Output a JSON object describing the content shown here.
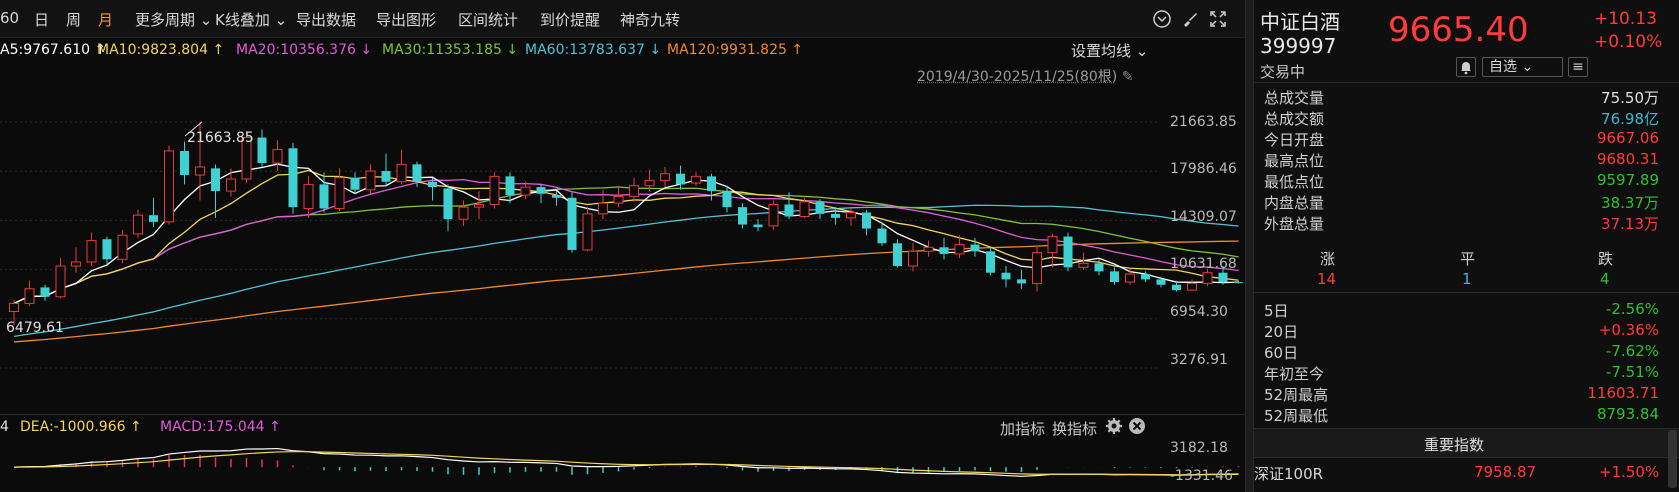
{
  "toolbar": {
    "items": [
      "60",
      "日",
      "周",
      "月",
      "更多周期",
      "K线叠加",
      "导出数据",
      "导出图形",
      "区间统计",
      "到价提醒",
      "神奇九转"
    ],
    "active": "月"
  },
  "ma_row": {
    "ma5": "A5:9767.610",
    "ma5_arrow": "↑",
    "ma10": "MA10:9823.804",
    "ma10_arrow": "↑",
    "ma20": "MA20:10356.376",
    "ma20_arrow": "↓",
    "ma30": "MA30:11353.185",
    "ma30_arrow": "↓",
    "ma60": "MA60:13783.637",
    "ma60_arrow": "↓",
    "ma120": "MA120:9931.825",
    "ma120_arrow": "↑",
    "settings_label": "设置均线"
  },
  "date_range": "2019/4/30-2025/11/25(80根)",
  "colors": {
    "up": "#e8383d",
    "down": "#3fd1d1",
    "ma5": "#ffffff",
    "ma10": "#f2d45c",
    "ma20": "#e05cd8",
    "ma30": "#7dc43a",
    "ma60": "#4fc4d6",
    "ma120": "#f0892c"
  },
  "chart_data": {
    "type": "candlestick",
    "title": "",
    "y_ticks": [
      "21663.85",
      "17986.46",
      "14309.07",
      "10631.68",
      "6954.30",
      "3276.91"
    ],
    "ylim": [
      3276.91,
      21663.85
    ],
    "annotations": {
      "high": "21663.85",
      "low": "6479.61"
    },
    "candles": [
      {
        "o": 7500,
        "c": 8100,
        "h": 8400,
        "l": 6479.61
      },
      {
        "o": 8100,
        "c": 9200,
        "h": 9800,
        "l": 7900
      },
      {
        "o": 9300,
        "c": 8600,
        "h": 9500,
        "l": 8300
      },
      {
        "o": 8600,
        "c": 10900,
        "h": 11500,
        "l": 8500
      },
      {
        "o": 10900,
        "c": 11200,
        "h": 12300,
        "l": 10400
      },
      {
        "o": 11200,
        "c": 12800,
        "h": 13400,
        "l": 10900
      },
      {
        "o": 12900,
        "c": 11400,
        "h": 13100,
        "l": 11000
      },
      {
        "o": 11400,
        "c": 13200,
        "h": 13600,
        "l": 11100
      },
      {
        "o": 13300,
        "c": 14700,
        "h": 15100,
        "l": 13000
      },
      {
        "o": 14700,
        "c": 14200,
        "h": 16000,
        "l": 13800
      },
      {
        "o": 14200,
        "c": 19500,
        "h": 19900,
        "l": 14000
      },
      {
        "o": 19500,
        "c": 17700,
        "h": 20200,
        "l": 17000
      },
      {
        "o": 17700,
        "c": 18300,
        "h": 21663.85,
        "l": 15800
      },
      {
        "o": 18200,
        "c": 16500,
        "h": 18500,
        "l": 14500
      },
      {
        "o": 16500,
        "c": 17400,
        "h": 18200,
        "l": 16100
      },
      {
        "o": 17400,
        "c": 20500,
        "h": 21000,
        "l": 17100
      },
      {
        "o": 20500,
        "c": 18600,
        "h": 21100,
        "l": 18300
      },
      {
        "o": 18600,
        "c": 19600,
        "h": 20300,
        "l": 18000
      },
      {
        "o": 19700,
        "c": 15300,
        "h": 20100,
        "l": 14800
      },
      {
        "o": 15200,
        "c": 17000,
        "h": 17600,
        "l": 14500
      },
      {
        "o": 17000,
        "c": 15200,
        "h": 17900,
        "l": 14900
      },
      {
        "o": 15200,
        "c": 17500,
        "h": 18200,
        "l": 15000
      },
      {
        "o": 17500,
        "c": 16600,
        "h": 17900,
        "l": 16300
      },
      {
        "o": 16600,
        "c": 18000,
        "h": 18500,
        "l": 16300
      },
      {
        "o": 18000,
        "c": 17200,
        "h": 19300,
        "l": 16900
      },
      {
        "o": 17200,
        "c": 18500,
        "h": 19600,
        "l": 17000
      },
      {
        "o": 18500,
        "c": 17200,
        "h": 18700,
        "l": 16800
      },
      {
        "o": 17200,
        "c": 16800,
        "h": 17500,
        "l": 15800
      },
      {
        "o": 16700,
        "c": 14400,
        "h": 17000,
        "l": 13500
      },
      {
        "o": 14400,
        "c": 15300,
        "h": 15800,
        "l": 13900
      },
      {
        "o": 15300,
        "c": 15500,
        "h": 16500,
        "l": 14400
      },
      {
        "o": 15500,
        "c": 17600,
        "h": 17900,
        "l": 15200
      },
      {
        "o": 17600,
        "c": 16200,
        "h": 17900,
        "l": 15600
      },
      {
        "o": 16200,
        "c": 16800,
        "h": 17200,
        "l": 15900
      },
      {
        "o": 16800,
        "c": 16300,
        "h": 17000,
        "l": 15600
      },
      {
        "o": 16200,
        "c": 16000,
        "h": 16500,
        "l": 15400
      },
      {
        "o": 16000,
        "c": 12100,
        "h": 16400,
        "l": 11900
      },
      {
        "o": 12100,
        "c": 14800,
        "h": 15300,
        "l": 12000
      },
      {
        "o": 14800,
        "c": 15600,
        "h": 16600,
        "l": 14400
      },
      {
        "o": 15600,
        "c": 16100,
        "h": 16900,
        "l": 15300
      },
      {
        "o": 16100,
        "c": 16900,
        "h": 17500,
        "l": 15700
      },
      {
        "o": 16900,
        "c": 17300,
        "h": 18100,
        "l": 16500
      },
      {
        "o": 17300,
        "c": 17800,
        "h": 18300,
        "l": 16800
      },
      {
        "o": 17800,
        "c": 17000,
        "h": 18400,
        "l": 16600
      },
      {
        "o": 17100,
        "c": 17600,
        "h": 17900,
        "l": 16900
      },
      {
        "o": 17600,
        "c": 16500,
        "h": 17800,
        "l": 15800
      },
      {
        "o": 16500,
        "c": 15300,
        "h": 16900,
        "l": 14900
      },
      {
        "o": 15300,
        "c": 14000,
        "h": 15600,
        "l": 13700
      },
      {
        "o": 14000,
        "c": 13800,
        "h": 14400,
        "l": 13500
      },
      {
        "o": 13900,
        "c": 15500,
        "h": 15800,
        "l": 13600
      },
      {
        "o": 15500,
        "c": 14600,
        "h": 16400,
        "l": 14400
      },
      {
        "o": 14600,
        "c": 15700,
        "h": 16000,
        "l": 14500
      },
      {
        "o": 15700,
        "c": 14800,
        "h": 15900,
        "l": 14400
      },
      {
        "o": 14800,
        "c": 14500,
        "h": 15300,
        "l": 14000
      },
      {
        "o": 14500,
        "c": 14900,
        "h": 15200,
        "l": 13900
      },
      {
        "o": 14900,
        "c": 13700,
        "h": 15100,
        "l": 13200
      },
      {
        "o": 13700,
        "c": 12600,
        "h": 14200,
        "l": 12400
      },
      {
        "o": 12600,
        "c": 10900,
        "h": 12900,
        "l": 10800
      },
      {
        "o": 10900,
        "c": 12000,
        "h": 12600,
        "l": 10500
      },
      {
        "o": 12000,
        "c": 12300,
        "h": 12800,
        "l": 11600
      },
      {
        "o": 12300,
        "c": 11800,
        "h": 13000,
        "l": 11400
      },
      {
        "o": 11800,
        "c": 12500,
        "h": 13200,
        "l": 11500
      },
      {
        "o": 12500,
        "c": 12000,
        "h": 13000,
        "l": 11600
      },
      {
        "o": 12000,
        "c": 10400,
        "h": 12300,
        "l": 10200
      },
      {
        "o": 10400,
        "c": 9900,
        "h": 10900,
        "l": 9300
      },
      {
        "o": 9900,
        "c": 9600,
        "h": 10600,
        "l": 9200
      },
      {
        "o": 9600,
        "c": 11900,
        "h": 12400,
        "l": 9000
      },
      {
        "o": 11900,
        "c": 13100,
        "h": 13300,
        "l": 10800
      },
      {
        "o": 13100,
        "c": 10800,
        "h": 13400,
        "l": 10500
      },
      {
        "o": 10800,
        "c": 11100,
        "h": 11900,
        "l": 10600
      },
      {
        "o": 11100,
        "c": 10500,
        "h": 11400,
        "l": 10200
      },
      {
        "o": 10500,
        "c": 9700,
        "h": 10800,
        "l": 9500
      },
      {
        "o": 9700,
        "c": 10300,
        "h": 10700,
        "l": 9500
      },
      {
        "o": 10300,
        "c": 9900,
        "h": 10500,
        "l": 9700
      },
      {
        "o": 9900,
        "c": 9500,
        "h": 10100,
        "l": 9300
      },
      {
        "o": 9500,
        "c": 9100,
        "h": 9800,
        "l": 9000
      },
      {
        "o": 9100,
        "c": 9600,
        "h": 9900,
        "l": 9000
      },
      {
        "o": 9600,
        "c": 10400,
        "h": 10700,
        "l": 9400
      },
      {
        "o": 10400,
        "c": 9700,
        "h": 10900,
        "l": 9500
      },
      {
        "o": 9700,
        "c": 9665.4,
        "h": 9780,
        "l": 9597.89
      }
    ]
  },
  "macd_header": {
    "dif_partial": "4",
    "dea": "DEA:-1000.966",
    "dea_arrow": "↑",
    "macd": "MACD:175.044",
    "macd_arrow": "↑",
    "add_indicator": "加指标",
    "switch_indicator": "换指标"
  },
  "macd_data": {
    "y_ticks": [
      "3182.18",
      "-1331.46"
    ],
    "ylim": [
      -1331.46,
      3182.18
    ]
  },
  "quote": {
    "name": "中证白酒",
    "code": "399997",
    "price": "9665.40",
    "change": "+10.13",
    "change_pct": "+0.10%",
    "status": "交易中",
    "watchlist_label": "自选"
  },
  "stats": [
    {
      "label": "总成交量",
      "value": "75.50万",
      "tone": "white"
    },
    {
      "label": "总成交额",
      "value": "76.98亿",
      "tone": "cyan"
    },
    {
      "label": "今日开盘",
      "value": "9667.06",
      "tone": "red"
    },
    {
      "label": "最高点位",
      "value": "9680.31",
      "tone": "red"
    },
    {
      "label": "最低点位",
      "value": "9597.89",
      "tone": "green"
    },
    {
      "label": "内盘总量",
      "value": "38.37万",
      "tone": "green"
    },
    {
      "label": "外盘总量",
      "value": "37.13万",
      "tone": "red"
    }
  ],
  "breadth": {
    "up_label": "涨",
    "flat_label": "平",
    "down_label": "跌",
    "up": "14",
    "flat": "1",
    "down": "4"
  },
  "periods": [
    {
      "label": "5日",
      "value": "-2.56%",
      "tone": "green"
    },
    {
      "label": "20日",
      "value": "+0.36%",
      "tone": "red"
    },
    {
      "label": "60日",
      "value": "-7.62%",
      "tone": "green"
    },
    {
      "label": "年初至今",
      "value": "-7.51%",
      "tone": "green"
    },
    {
      "label": "52周最高",
      "value": "11603.71",
      "tone": "red"
    },
    {
      "label": "52周最低",
      "value": "8793.84",
      "tone": "green"
    }
  ],
  "important_index": {
    "title": "重要指数",
    "rows": [
      {
        "name": "深证100R",
        "price": "7958.87",
        "change": "+1.50%"
      }
    ]
  }
}
